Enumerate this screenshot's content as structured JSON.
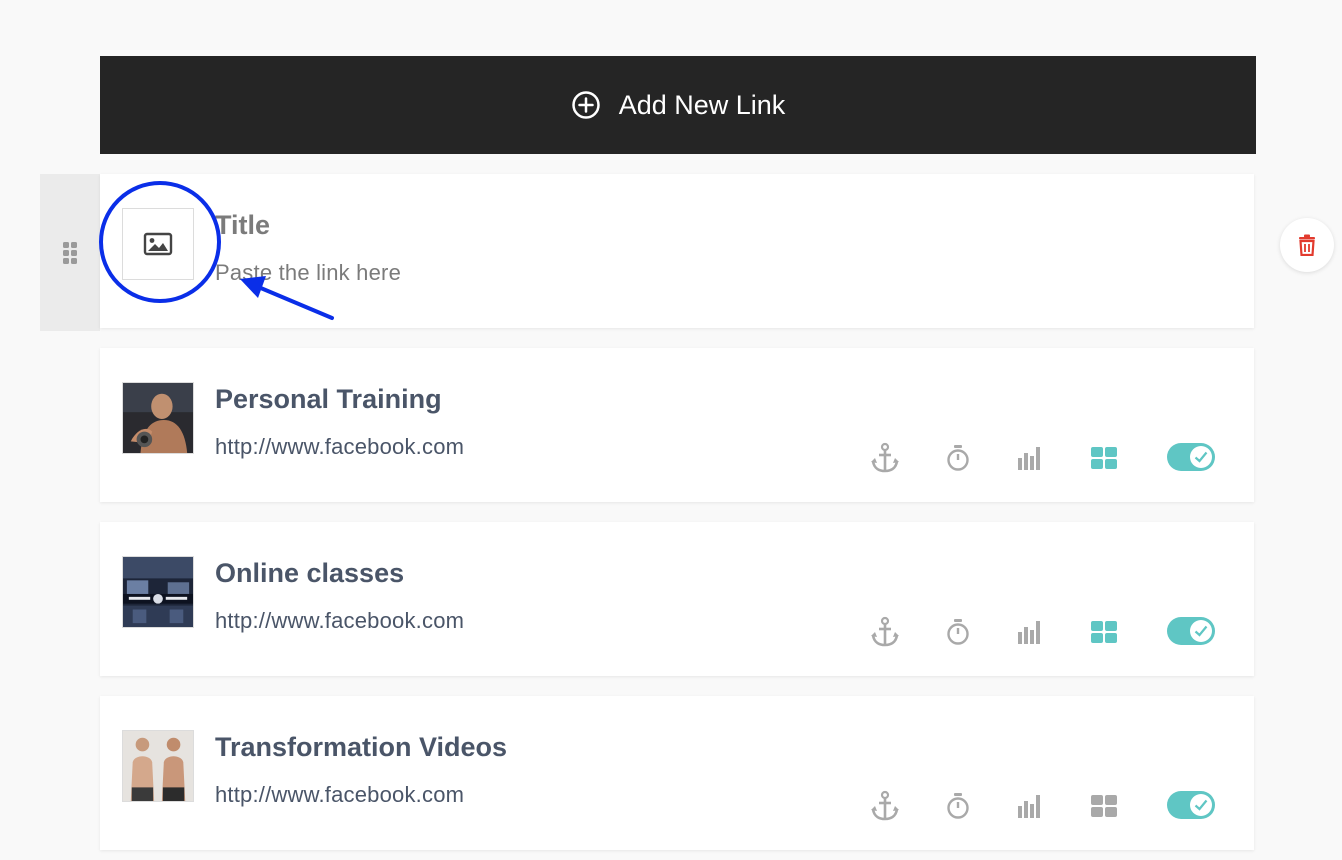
{
  "add_button": {
    "label": "Add New Link",
    "icon": "plus-circle-icon"
  },
  "new_link": {
    "title_placeholder": "Title",
    "url_placeholder": "Paste the link here",
    "thumbnail_icon": "image-icon"
  },
  "links": [
    {
      "title": "Personal Training",
      "url": "http://www.facebook.com",
      "thumbnail": "personal-training-photo",
      "layout_active": true,
      "enabled": true
    },
    {
      "title": "Online classes",
      "url": "http://www.facebook.com",
      "thumbnail": "online-classes-photo",
      "layout_active": true,
      "enabled": true
    },
    {
      "title": "Transformation Videos",
      "url": "http://www.facebook.com",
      "thumbnail": "transformation-photo",
      "layout_active": false,
      "enabled": true
    }
  ],
  "colors": {
    "accent_teal": "#5fc6c4",
    "dark_bar": "#252525",
    "icon_gray": "#a9a9a9",
    "delete_red": "#e23b2e",
    "annotation_blue": "#0a2ee8"
  }
}
